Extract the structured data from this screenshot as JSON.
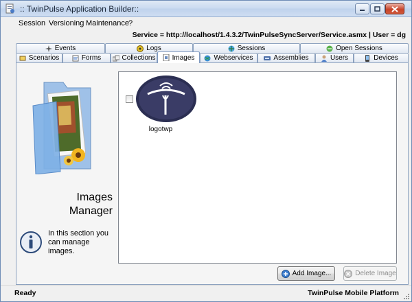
{
  "window": {
    "title": ":: TwinPulse Application Builder::"
  },
  "menu": [
    "Session",
    "Versioning",
    "Maintenance",
    "?"
  ],
  "info": {
    "service": "Service = http://localhost/1.4.3.2/TwinPulseSyncServer/Service.asmx | User = dg"
  },
  "tabs_top": [
    {
      "label": "Events",
      "icon": "events-icon"
    },
    {
      "label": "Logs",
      "icon": "logs-icon"
    },
    {
      "label": "Sessions",
      "icon": "sessions-icon"
    },
    {
      "label": "Open Sessions",
      "icon": "open-sessions-icon"
    }
  ],
  "tabs_bottom": [
    {
      "label": "Scenarios",
      "icon": "scenarios-icon"
    },
    {
      "label": "Forms",
      "icon": "forms-icon"
    },
    {
      "label": "Collections",
      "icon": "collections-icon"
    },
    {
      "label": "Images",
      "icon": "images-icon",
      "selected": true
    },
    {
      "label": "Webservices",
      "icon": "webservices-icon"
    },
    {
      "label": "Assemblies",
      "icon": "assemblies-icon"
    },
    {
      "label": "Users",
      "icon": "users-icon"
    },
    {
      "label": "Devices",
      "icon": "devices-icon"
    }
  ],
  "left_pane": {
    "title_line1": "Images",
    "title_line2": "Manager",
    "info_text": "In this section you can manage images."
  },
  "images": [
    {
      "label": "logotwp",
      "checked": false
    }
  ],
  "buttons": {
    "add": "Add Image...",
    "delete": "Delete Image"
  },
  "status": {
    "left": "Ready",
    "right": "TwinPulse Mobile Platform"
  }
}
